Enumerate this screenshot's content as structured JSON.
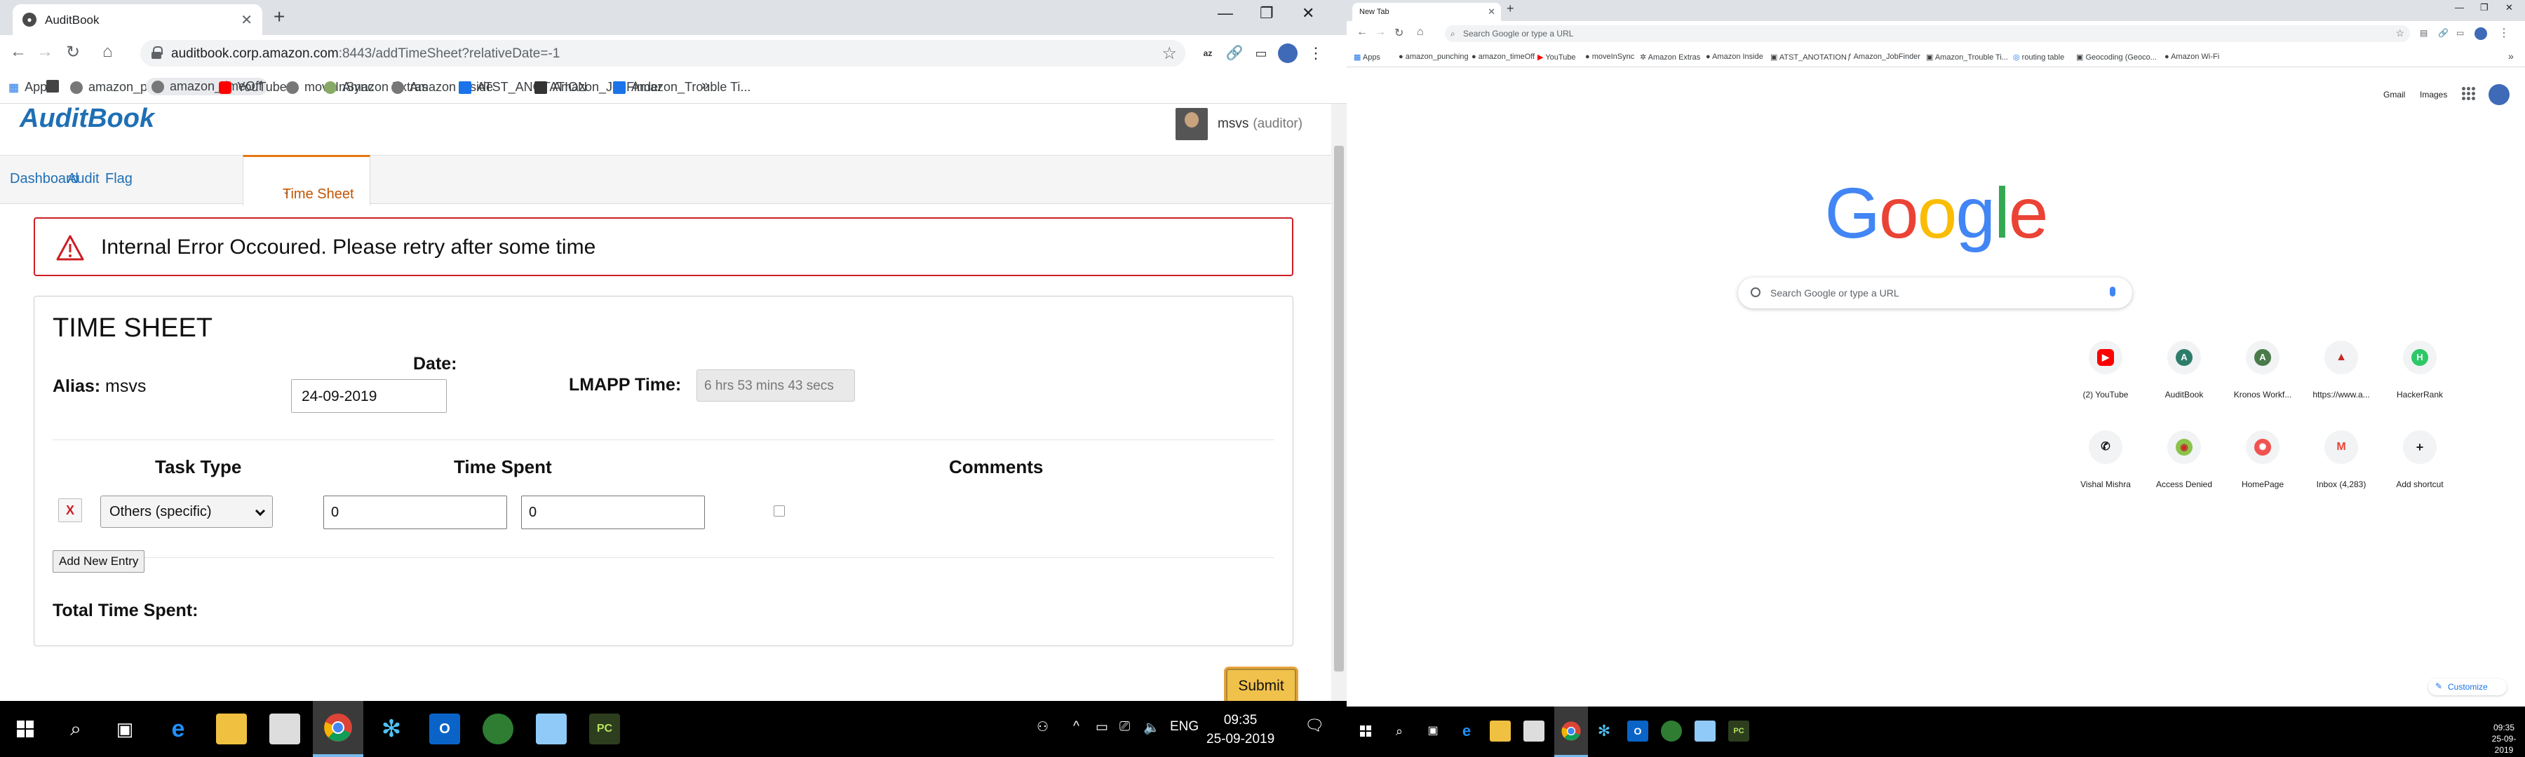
{
  "left": {
    "tab_title": "AuditBook",
    "url_main": "auditbook.corp.amazon.com",
    "url_rest": ":8443/addTimeSheet?relativeDate=-1",
    "bookmarks": [
      "Apps",
      "amazon_punching",
      "amazon_timeOff",
      "YouTube",
      "moveInSync",
      "Amazon Extras",
      "Amazon Inside",
      "ATST_ANOTATION",
      "Amazon_JobFinder",
      "Amazon_Trouble Ti..."
    ],
    "more_bookmarks": "»",
    "page": {
      "logo": "AuditBook",
      "user_name": "msvs",
      "user_role": "(auditor)",
      "nav": [
        "Dashboard",
        "Audit",
        "Flag",
        "Time Sheet"
      ],
      "alert": "Internal Error Occoured. Please retry after some time",
      "card_title": "TIME SHEET",
      "alias_label": "Alias:",
      "alias_value": "msvs",
      "date_label": "Date:",
      "date_value": "24-09-2019",
      "lmapp_label": "LMAPP Time:",
      "lmapp_value": "6 hrs 53 mins 43 secs",
      "col_task": "Task Type",
      "col_time": "Time Spent",
      "col_comments": "Comments",
      "delete_label": "X",
      "task_type": "Others (specific)",
      "time_spent_1": "0",
      "time_spent_2": "0",
      "add_entry": "Add New Entry",
      "total_label": "Total Time Spent:",
      "submit": "Submit"
    },
    "taskbar": {
      "lang": "ENG",
      "time": "09:35",
      "date": "25-09-2019"
    }
  },
  "right": {
    "tab_title": "New Tab",
    "omnibox_placeholder": "Search Google or type a URL",
    "bookmarks": [
      "Apps",
      "amazon_punching",
      "amazon_timeOff",
      "YouTube",
      "moveInSync",
      "Amazon Extras",
      "Amazon Inside",
      "ATST_ANOTATION",
      "Amazon_JobFinder",
      "Amazon_Trouble Ti...",
      "routing table",
      "Geocoding (Geoco...",
      "Amazon Wi-Fi"
    ],
    "top_links": [
      "Gmail",
      "Images"
    ],
    "logo_letters": [
      "G",
      "o",
      "o",
      "g",
      "l",
      "e"
    ],
    "search_placeholder": "Search Google or type a URL",
    "tiles": [
      "(2) YouTube",
      "AuditBook",
      "Kronos Workf...",
      "https://www.a...",
      "HackerRank",
      "Vishal Mishra",
      "Access Denied",
      "HomePage",
      "Inbox (4,283)",
      "Add shortcut"
    ],
    "customize": "Customize",
    "taskbar": {
      "time": "09:35",
      "date": "25-09-2019"
    }
  }
}
